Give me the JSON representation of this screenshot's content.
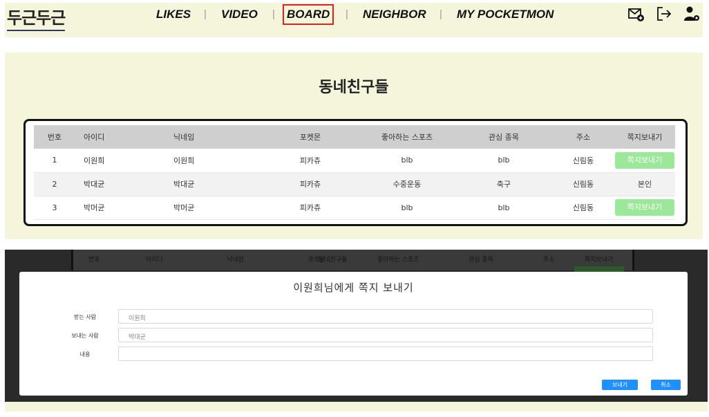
{
  "logo": "두근두근",
  "nav": {
    "items": [
      "LIKES",
      "VIDEO",
      "BOARD",
      "NEIGHBOR",
      "MY POCKETMON"
    ],
    "separator": "|",
    "active": "BOARD",
    "icons": [
      "mail-add-icon",
      "logout-icon",
      "user-settings-icon"
    ]
  },
  "section": {
    "title": "동네친구들",
    "columns": [
      "번호",
      "아이디",
      "닉네임",
      "포켓몬",
      "좋아하는 스포츠",
      "관심 종목",
      "주소",
      "쪽지보내기"
    ],
    "rows": [
      {
        "no": "1",
        "id": "이원희",
        "nickname": "이원희",
        "pokemon": "피카츄",
        "sport": "blb",
        "interest": "blb",
        "address": "신림동",
        "action": "쪽지보내기",
        "is_button": true
      },
      {
        "no": "2",
        "id": "박대균",
        "nickname": "박대균",
        "pokemon": "피카츄",
        "sport": "수중운동",
        "interest": "축구",
        "address": "신림동",
        "action": "본인",
        "is_button": false
      },
      {
        "no": "3",
        "id": "박머균",
        "nickname": "박머균",
        "pokemon": "피카츄",
        "sport": "blb",
        "interest": "blb",
        "address": "신림동",
        "action": "쪽지보내기",
        "is_button": true
      }
    ]
  },
  "modal": {
    "title": "이원희님에게 쪽지 보내기",
    "fields": [
      {
        "label": "받는 사람",
        "value": "이원희"
      },
      {
        "label": "보내는 사람",
        "value": "박대균"
      },
      {
        "label": "내용",
        "value": ""
      }
    ],
    "send_label": "보내기",
    "cancel_label": "취소"
  },
  "background_overlay": {
    "columns": [
      "번호",
      "아이디",
      "닉네임",
      "포켓몬",
      "좋아하는 스포츠",
      "관심 종목",
      "주소",
      "쪽지보내기"
    ],
    "title": "동네친구들"
  },
  "colors": {
    "beige": "#f5f5dc",
    "active_outline": "#e02020",
    "message_button": "#9be89b",
    "modal_button": "#1e90ff",
    "overlay": "#2a2a2a"
  }
}
